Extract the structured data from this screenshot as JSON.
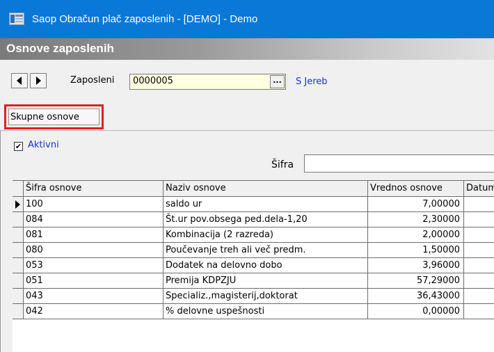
{
  "window": {
    "title": "Saop Obračun plač zaposlenih - [DEMO] - Demo",
    "icon": "app-window-icon",
    "accent": "#0a78d7"
  },
  "form": {
    "title": "Osnove zaposlenih"
  },
  "navigation": {
    "prev_icon": "arrow-left-icon",
    "next_icon": "arrow-right-icon",
    "employee_label": "Zaposleni",
    "employee_code": "0000005",
    "lookup_label": "...",
    "employee_name": "S Jereb"
  },
  "tabs": [
    {
      "label": "Skupne osnove",
      "highlight_color": "#e01f26"
    }
  ],
  "filters": {
    "active_label": "Aktivni",
    "active_checked": true,
    "sifra_label": "Šifra",
    "sifra_value": ""
  },
  "grid": {
    "columns": [
      "Šifra osnove",
      "Naziv osnove",
      "Vrednos osnove",
      "Datum"
    ],
    "rows": [
      {
        "code": "100",
        "name": "saldo ur",
        "value": "7,00000",
        "current": true
      },
      {
        "code": "084",
        "name": "Št.ur pov.obsega ped.dela-1,20",
        "value": "2,30000"
      },
      {
        "code": "081",
        "name": "Kombinacija (2 razreda)",
        "value": "2,00000"
      },
      {
        "code": "080",
        "name": "Poučevanje treh ali več predm.",
        "value": "1,50000"
      },
      {
        "code": "053",
        "name": "Dodatek na delovno dobo",
        "value": "3,96000"
      },
      {
        "code": "051",
        "name": "Premija KDPZJU",
        "value": "57,29000"
      },
      {
        "code": "043",
        "name": "Specializ.,magisterij,doktorat",
        "value": "36,43000"
      },
      {
        "code": "042",
        "name": "% delovne uspešnosti",
        "value": "0,00000"
      }
    ]
  }
}
